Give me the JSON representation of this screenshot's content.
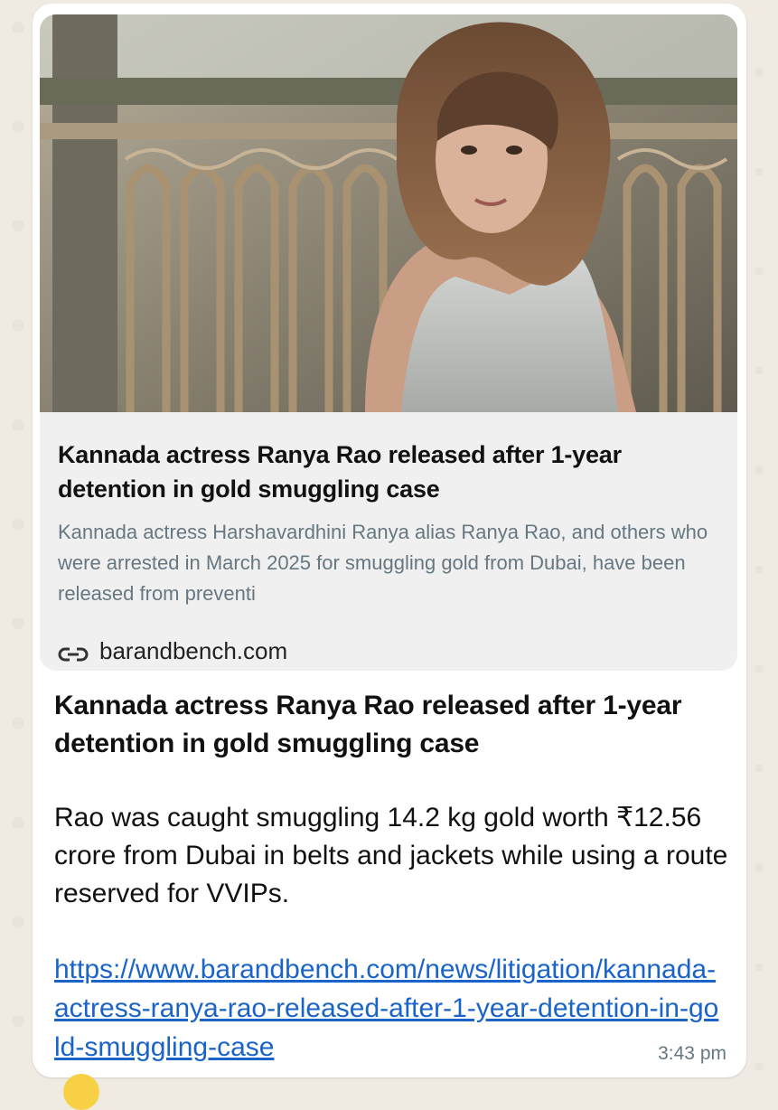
{
  "preview": {
    "title": "Kannada actress Ranya Rao released after 1-year detention in gold smuggling case",
    "description": "Kannada actress Harshavardhini Ranya alias Ranya Rao, and others who were arrested in March 2025 for smuggling gold from Dubai, have been released from preventi",
    "domain": "barandbench.com",
    "icon": "link-icon"
  },
  "message": {
    "title": "Kannada actress Ranya Rao released after 1-year detention in gold smuggling case",
    "body": "Rao was caught smuggling 14.2 kg gold worth ₹12.56 crore from Dubai in belts and jackets while using a route reserved for VVIPs.",
    "link": "https://www.barandbench.com/news/litigation/kannada-actress-ranya-rao-released-after-1-year-detention-in-gold-smuggling-case",
    "time": "3:43 pm"
  },
  "colors": {
    "bubble": "#ffffff",
    "card": "#f0f0f0",
    "link": "#1a64c9",
    "meta": "#667781",
    "wallpaper": "#efeae2"
  }
}
